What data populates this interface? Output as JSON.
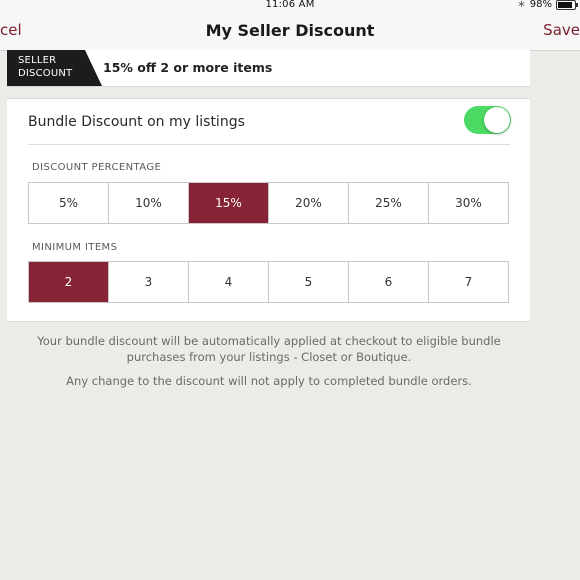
{
  "status_bar": {
    "time": "11:06 AM",
    "battery": "98%",
    "icons": [
      "bluetooth-icon",
      "battery-icon"
    ]
  },
  "nav": {
    "cancel_label": "cel",
    "title": "My Seller Discount",
    "save_label": "Save"
  },
  "banner": {
    "tag_text": "SELLER\nDISCOUNT",
    "text": "15% off 2 or more items"
  },
  "bundle": {
    "label": "Bundle Discount on my listings",
    "enabled": true
  },
  "discount_percentage": {
    "label": "DISCOUNT PERCENTAGE",
    "options": [
      "5%",
      "10%",
      "15%",
      "20%",
      "25%",
      "30%"
    ],
    "selected": "15%"
  },
  "minimum_items": {
    "label": "MINIMUM ITEMS",
    "options": [
      "2",
      "3",
      "4",
      "5",
      "6",
      "7"
    ],
    "selected": "2"
  },
  "info": {
    "line1": "Your bundle discount will be automatically applied at checkout to eligible bundle purchases from your listings - Closet or Boutique.",
    "line2": "Any change to the discount will not apply to completed bundle orders."
  },
  "colors": {
    "accent": "#862334",
    "nav_link": "#7a1d2c",
    "toggle_on": "#4cd964",
    "background": "#ecebe7"
  }
}
